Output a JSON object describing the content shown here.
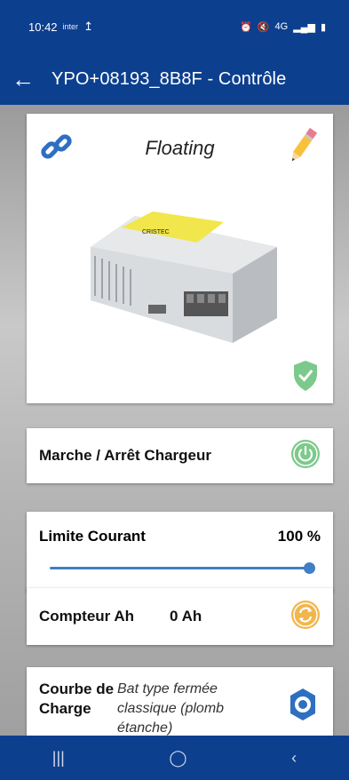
{
  "status_bar": {
    "time": "10:42",
    "carrier_small": "inter",
    "upload_icon": "upload-icon",
    "net": "4G"
  },
  "app_bar": {
    "title": "YPO+08193_8B8F - Contrôle",
    "back_icon": "arrow-back-icon"
  },
  "hero": {
    "state": "Floating"
  },
  "onoff": {
    "label": "Marche / Arrêt Chargeur"
  },
  "limit": {
    "label": "Limite Courant",
    "value": "100 %",
    "level": 1.0
  },
  "ah": {
    "label": "Compteur Ah",
    "value": "0 Ah"
  },
  "courbe": {
    "label": "Courbe de Charge",
    "desc": "Bat type fermée classique (plomb étanche)"
  },
  "device": {
    "brand": "CRISTEC"
  },
  "colors": {
    "primary": "#0d3f8f",
    "accent": "#3f7fc4",
    "green": "#7dc98b",
    "orange": "#f2b64c"
  }
}
